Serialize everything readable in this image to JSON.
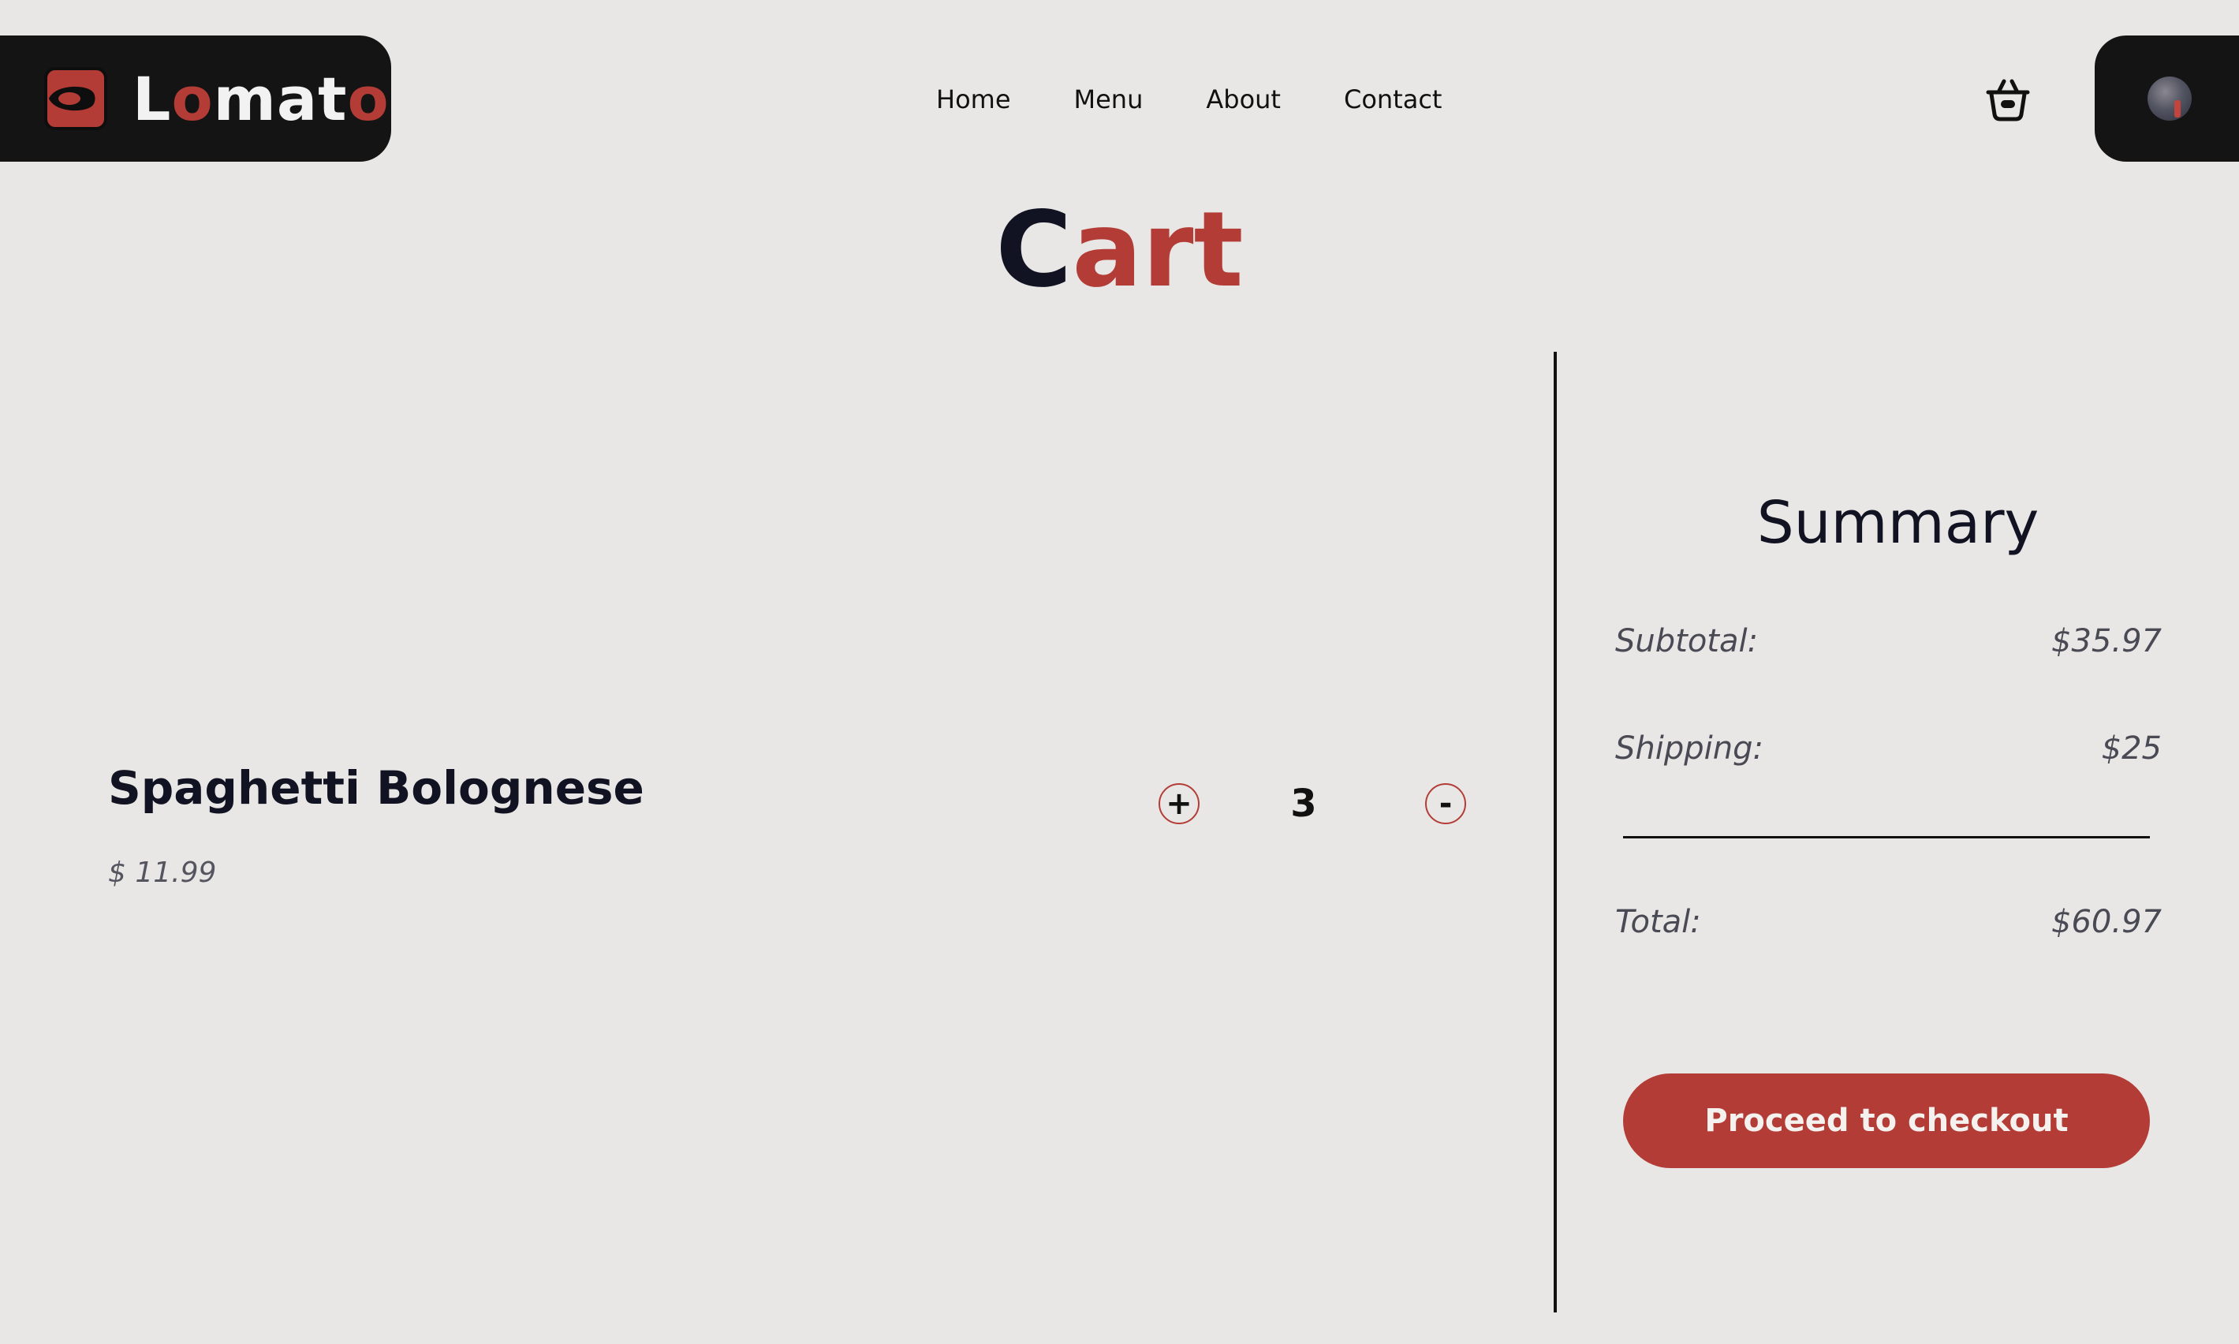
{
  "header": {
    "brand": {
      "name_parts": [
        "L",
        "o",
        "mat",
        "o"
      ],
      "logo_icon": "lomato-logo-icon"
    },
    "nav": [
      "Home",
      "Menu",
      "About",
      "Contact"
    ],
    "cart_icon": "basket-icon",
    "avatar_icon": "user-avatar"
  },
  "title": {
    "part1": "C",
    "part2": "art"
  },
  "cart": {
    "items": [
      {
        "name": "Spaghetti Bolognese",
        "price": "$ 11.99",
        "quantity": "3",
        "increment_label": "+",
        "decrement_label": "-"
      }
    ]
  },
  "summary": {
    "title": "Summary",
    "subtotal_label": "Subtotal:",
    "subtotal_value": "$35.97",
    "shipping_label": "Shipping:",
    "shipping_value": "$25",
    "total_label": "Total:",
    "total_value": "$60.97",
    "checkout_label": "Proceed to checkout"
  },
  "colors": {
    "accent": "#b43c36",
    "background": "#e8e7e5",
    "dark": "#141414",
    "text": "#111322"
  }
}
